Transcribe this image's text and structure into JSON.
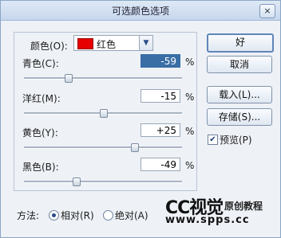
{
  "window": {
    "title": "可选颜色选项",
    "close_icon": "×"
  },
  "colors_select": {
    "label": "颜色(O):",
    "value": "红色",
    "swatch_color": "#e60000"
  },
  "rows": [
    {
      "label": "青色(C):",
      "value": "-59",
      "unit": "%",
      "slider_fraction": 0.28
    },
    {
      "label": "洋红(M):",
      "value": "-15",
      "unit": "%",
      "slider_fraction": 0.5
    },
    {
      "label": "黄色(Y):",
      "value": "+25",
      "unit": "%",
      "slider_fraction": 0.7
    },
    {
      "label": "黑色(B):",
      "value": "-49",
      "unit": "%",
      "slider_fraction": 0.33
    }
  ],
  "buttons": {
    "ok": "好",
    "cancel": "取消",
    "load": "载入(L)...",
    "save": "存储(S)..."
  },
  "preview": {
    "label": "预览(P)",
    "checked": true
  },
  "method": {
    "label": "方法:",
    "options": [
      "相对(R)",
      "绝对(A)"
    ],
    "selected": "相对(R)"
  },
  "watermark": {
    "logo": "CC视觉",
    "text": "原创教程",
    "url": "www.spps.cc"
  }
}
